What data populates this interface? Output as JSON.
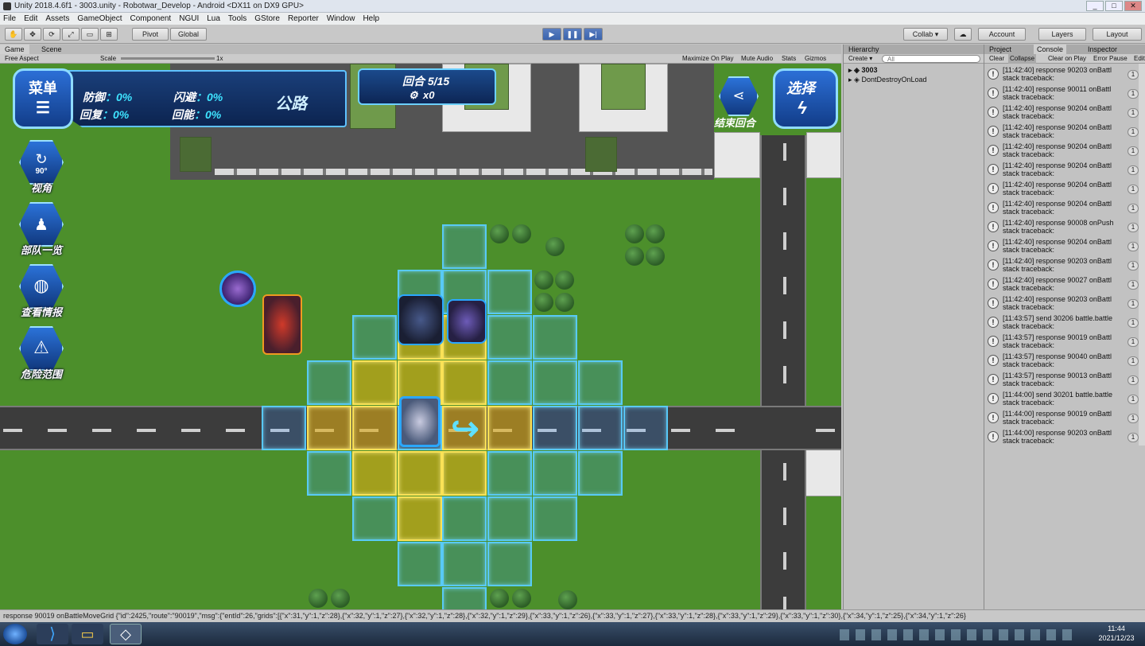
{
  "window": {
    "title": "Unity 2018.4.6f1 - 3003.unity - Robotwar_Develop - Android <DX11 on DX9 GPU>",
    "minimize": "_",
    "maximize": "□",
    "close": "✕"
  },
  "menu": [
    "File",
    "Edit",
    "Assets",
    "GameObject",
    "Component",
    "NGUI",
    "Lua",
    "Tools",
    "GStore",
    "Reporter",
    "Window",
    "Help"
  ],
  "toolbar": {
    "pivot": "Pivot",
    "global": "Global",
    "collab": "Collab ▾",
    "account": "Account",
    "layers": "Layers",
    "layout": "Layout"
  },
  "game_panel": {
    "tab_game": "Game",
    "tab_scene": "Scene",
    "aspect": "Free Aspect",
    "scale_label": "Scale",
    "scale_value": "1x",
    "maximize_on_play": "Maximize On Play",
    "mute_audio": "Mute Audio",
    "stats": "Stats",
    "gizmos": "Gizmos"
  },
  "hud": {
    "menu_label": "菜单",
    "defense_label": "防御",
    "defense_value": "：0%",
    "evade_label": "闪避",
    "evade_value": "：0%",
    "recover_label": "回复",
    "recover_value": "：0%",
    "energy_label": "回能",
    "energy_value": "：0%",
    "terrain": "公路",
    "round": "回合 5/15",
    "gear_count": "x0",
    "end_round": "结束回合",
    "select": "选择",
    "side_buttons": [
      {
        "label": "视角",
        "icon": "rotate-90-icon",
        "sub": "90°"
      },
      {
        "label": "部队一览",
        "icon": "squad-icon",
        "sub": ""
      },
      {
        "label": "查看情报",
        "icon": "globe-icon",
        "sub": ""
      },
      {
        "label": "危险范围",
        "icon": "warning-icon",
        "sub": ""
      }
    ]
  },
  "hierarchy": {
    "tab": "Hierarchy",
    "create": "Create ▾",
    "search_placeholder": "All",
    "items": [
      "3003",
      "DontDestroyOnLoad"
    ]
  },
  "console": {
    "tab_project": "Project",
    "tab_console": "Console",
    "tab_inspector": "Inspector",
    "clear": "Clear",
    "collapse": "Collapse",
    "clear_on_play": "Clear on Play",
    "error_pause": "Error Pause",
    "edit": "Edit",
    "entries": [
      {
        "text": "[11:42:40] response 90203 onBattl",
        "trace": "stack traceback:",
        "count": "1"
      },
      {
        "text": "[11:42:40] response 90011 onBattl",
        "trace": "stack traceback:",
        "count": "1"
      },
      {
        "text": "[11:42:40] response 90204 onBattl",
        "trace": "stack traceback:",
        "count": "1"
      },
      {
        "text": "[11:42:40] response 90204 onBattl",
        "trace": "stack traceback:",
        "count": "1"
      },
      {
        "text": "[11:42:40] response 90204 onBattl",
        "trace": "stack traceback:",
        "count": "1"
      },
      {
        "text": "[11:42:40] response 90204 onBattl",
        "trace": "stack traceback:",
        "count": "1"
      },
      {
        "text": "[11:42:40] response 90204 onBattl",
        "trace": "stack traceback:",
        "count": "1"
      },
      {
        "text": "[11:42:40] response 90204 onBattl",
        "trace": "stack traceback:",
        "count": "1"
      },
      {
        "text": "[11:42:40] response 90008 onPush",
        "trace": "stack traceback:",
        "count": "1"
      },
      {
        "text": "[11:42:40] response 90204 onBattl",
        "trace": "stack traceback:",
        "count": "1"
      },
      {
        "text": "[11:42:40] response 90203 onBattl",
        "trace": "stack traceback:",
        "count": "1"
      },
      {
        "text": "[11:42:40] response 90027 onBattl",
        "trace": "stack traceback:",
        "count": "1"
      },
      {
        "text": "[11:42:40] response 90203 onBattl",
        "trace": "stack traceback:",
        "count": "1"
      },
      {
        "text": "[11:43:57] send 30206 battle.battle",
        "trace": "stack traceback:",
        "count": "1"
      },
      {
        "text": "[11:43:57] response 90019 onBattl",
        "trace": "stack traceback:",
        "count": "1"
      },
      {
        "text": "[11:43:57] response 90040 onBattl",
        "trace": "stack traceback:",
        "count": "1"
      },
      {
        "text": "[11:43:57] response 90013 onBattl",
        "trace": "stack traceback:",
        "count": "1"
      },
      {
        "text": "[11:44:00] send 30201 battle.battle",
        "trace": "stack traceback:",
        "count": "1"
      },
      {
        "text": "[11:44:00] response 90019 onBattl",
        "trace": "stack traceback:",
        "count": "1"
      },
      {
        "text": "[11:44:00] response 90203 onBattl",
        "trace": "stack traceback:",
        "count": "1"
      }
    ]
  },
  "status_bar": "response 90019 onBattleMoveGrid  {\"id\":2425,\"route\":\"90019\",\"msg\":{\"entId\":26,\"grids\":[{\"x\":31,\"y\":1,\"z\":28},{\"x\":32,\"y\":1,\"z\":27},{\"x\":32,\"y\":1,\"z\":28},{\"x\":32,\"y\":1,\"z\":29},{\"x\":33,\"y\":1,\"z\":26},{\"x\":33,\"y\":1,\"z\":27},{\"x\":33,\"y\":1,\"z\":28},{\"x\":33,\"y\":1,\"z\":29},{\"x\":33,\"y\":1,\"z\":30},{\"x\":34,\"y\":1,\"z\":25},{\"x\":34,\"y\":1,\"z\":26}",
  "taskbar": {
    "time": "11:44",
    "date": "2021/12/23",
    "apps": [
      "windows-start-icon",
      "vscode-icon",
      "file-explorer-icon",
      "unity-icon"
    ]
  }
}
